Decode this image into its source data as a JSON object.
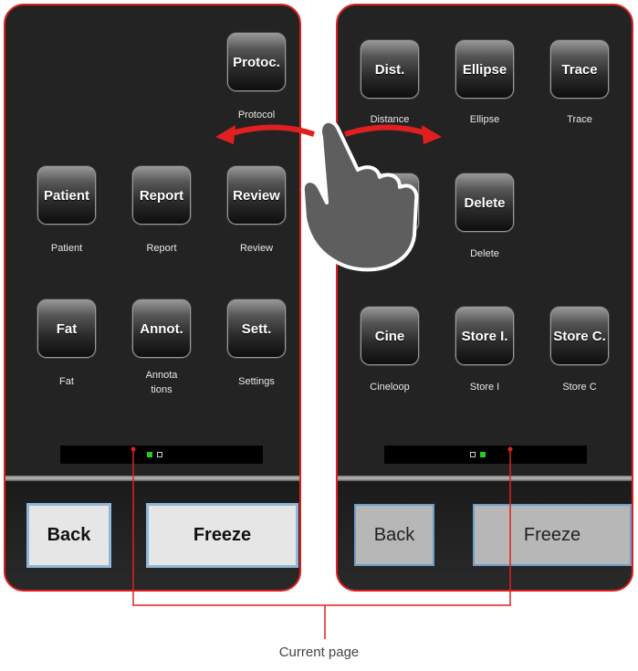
{
  "left_screen": {
    "tiles": [
      {
        "label": "Protoc.",
        "caption": "Protocol"
      },
      {
        "label": "Patient",
        "caption": "Patient"
      },
      {
        "label": "Report",
        "caption": "Report"
      },
      {
        "label": "Review",
        "caption": "Review"
      },
      {
        "label": "Fat",
        "caption": "Fat"
      },
      {
        "label": "Annot.",
        "caption": "Annota\ntions"
      },
      {
        "label": "Sett.",
        "caption": "Settings"
      }
    ],
    "back_label": "Back",
    "freeze_label": "Freeze"
  },
  "right_screen": {
    "tiles": [
      {
        "label": "Dist.",
        "caption": "Distance"
      },
      {
        "label": "Ellipse",
        "caption": "Ellipse"
      },
      {
        "label": "Trace",
        "caption": "Trace"
      },
      {
        "label": "",
        "caption": ""
      },
      {
        "label": "Delete",
        "caption": "Delete"
      },
      {
        "label": "Cine",
        "caption": "Cineloop"
      },
      {
        "label": "Store I.",
        "caption": "Store I"
      },
      {
        "label": "Store C.",
        "caption": "Store C"
      }
    ],
    "back_label": "Back",
    "freeze_label": "Freeze"
  },
  "caption": "Current page",
  "colors": {
    "frame": "#e02020",
    "active_dot": "#22cc22",
    "annotation_line": "#e02020"
  }
}
